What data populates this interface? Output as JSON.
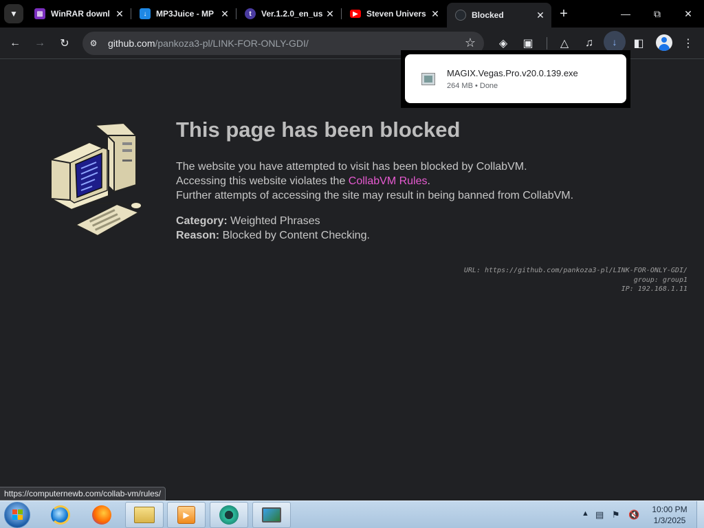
{
  "browser": {
    "tabs": [
      {
        "title": "WinRAR downl",
        "favicon": "winrar-icon",
        "color": "#7b2fbf"
      },
      {
        "title": "MP3Juice - MP",
        "favicon": "mp3juice-icon",
        "color": "#1e88e5"
      },
      {
        "title": "Ver.1.2.0_en_us",
        "favicon": "tumblr-icon",
        "color": "#4a3ba0"
      },
      {
        "title": "Steven Univers",
        "favicon": "youtube-icon",
        "color": "#ff0000"
      },
      {
        "title": "Blocked",
        "favicon": "github-icon",
        "color": "#24292f"
      }
    ],
    "active_tab_index": 4,
    "url_host": "github.com",
    "url_path": "/pankoza3-pl/LINK-FOR-ONLY-GDI/"
  },
  "download": {
    "filename": "MAGIX.Vegas.Pro.v20.0.139.exe",
    "meta": "264 MB • Done"
  },
  "page": {
    "heading": "This page has been blocked",
    "line1": "The website you have attempted to visit has been blocked by CollabVM.",
    "line2_prefix": "Accessing this website violates the ",
    "line2_link": "CollabVM Rules",
    "line2_suffix": ".",
    "line3": "Further attempts of accessing the site may result in being banned from CollabVM.",
    "category_label": "Category:",
    "category_value": "Weighted Phrases",
    "reason_label": "Reason:",
    "reason_value": "Blocked by Content Checking.",
    "url_meta": "URL: https://github.com/pankoza3-pl/LINK-FOR-ONLY-GDI/",
    "group_meta": "group: group1",
    "ip_meta": "IP: 192.168.1.11",
    "link_color": "#e75ad1"
  },
  "status_bar": {
    "hover_url": "https://computernewb.com/collab-vm/rules/"
  },
  "taskbar": {
    "apps": [
      "internet-explorer-icon",
      "firefox-icon",
      "file-explorer-icon",
      "media-player-icon",
      "chrome-icon",
      "monitor-app-icon"
    ],
    "time": "10:00 PM",
    "date": "1/3/2025"
  }
}
